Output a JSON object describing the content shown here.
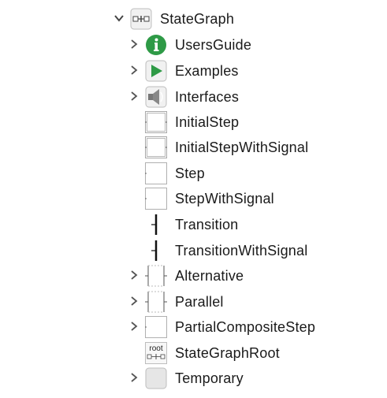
{
  "tree": {
    "root": {
      "label": "StateGraph",
      "icon": "stategraph-package-icon",
      "expanded": true
    },
    "items": [
      {
        "label": "UsersGuide",
        "icon": "info-icon",
        "expandable": true
      },
      {
        "label": "Examples",
        "icon": "play-icon",
        "expandable": true
      },
      {
        "label": "Interfaces",
        "icon": "connector-icon",
        "expandable": true
      },
      {
        "label": "InitialStep",
        "icon": "initial-step-icon",
        "expandable": false
      },
      {
        "label": "InitialStepWithSignal",
        "icon": "initial-step-with-signal-icon",
        "expandable": false
      },
      {
        "label": "Step",
        "icon": "step-icon",
        "expandable": false
      },
      {
        "label": "StepWithSignal",
        "icon": "step-with-signal-icon",
        "expandable": false
      },
      {
        "label": "Transition",
        "icon": "transition-icon",
        "expandable": false
      },
      {
        "label": "TransitionWithSignal",
        "icon": "transition-with-signal-icon",
        "expandable": false
      },
      {
        "label": "Alternative",
        "icon": "alternative-icon",
        "expandable": true
      },
      {
        "label": "Parallel",
        "icon": "parallel-icon",
        "expandable": true
      },
      {
        "label": "PartialCompositeStep",
        "icon": "composite-step-icon",
        "expandable": true
      },
      {
        "label": "StateGraphRoot",
        "icon": "root-icon",
        "expandable": false
      },
      {
        "label": "Temporary",
        "icon": "package-icon",
        "expandable": true
      }
    ],
    "root_icon_text": "root",
    "colors": {
      "info_green": "#2e9a46",
      "play_green": "#2e9a46",
      "arrow_gray": "#555555",
      "box_border": "#b8b8b8"
    }
  }
}
